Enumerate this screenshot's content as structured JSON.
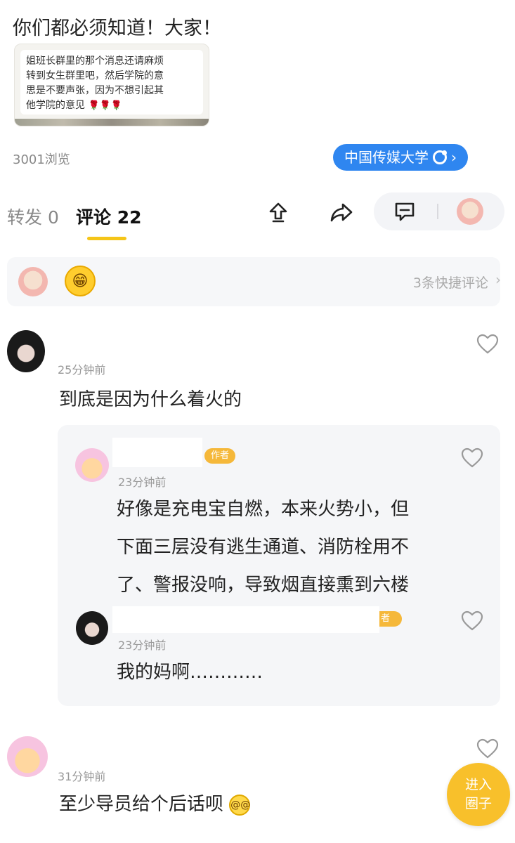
{
  "post": {
    "text": "你们都必须知道！大家！",
    "quote_line1": "姐班长群里的那个消息还请麻烦",
    "quote_line2": "转到女生群里吧，然后学院的意",
    "quote_line3": "思是不要声张，因为不想引起其",
    "quote_line4": "他学院的意见",
    "views": "3001浏览",
    "circle_label": "中国传媒大学"
  },
  "tabs": {
    "forward": "转发 0",
    "comments": "评论 22"
  },
  "quick_comments": {
    "count_label": "3条快捷评论"
  },
  "comments": [
    {
      "time": "25分钟前",
      "text": "到底是因为什么着火的",
      "replies": [
        {
          "badge": "作者",
          "time": "23分钟前",
          "line1": "好像是充电宝自燃，本来火势小，但",
          "line2": "下面三层没有逃生通道、消防栓用不",
          "line3": "了、警报没响，导致烟直接熏到六楼"
        },
        {
          "badge": "者",
          "time": "23分钟前",
          "text": "我的妈啊…………"
        }
      ]
    },
    {
      "time": "31分钟前",
      "text": "至少导员给个后话呗"
    }
  ],
  "fab": {
    "line1": "进入",
    "line2": "圈子"
  },
  "colors": {
    "accent_yellow": "#f5c518",
    "circle_blue": "#2f86f0",
    "author_badge": "#f5b83a",
    "fab": "#f8c02b"
  }
}
